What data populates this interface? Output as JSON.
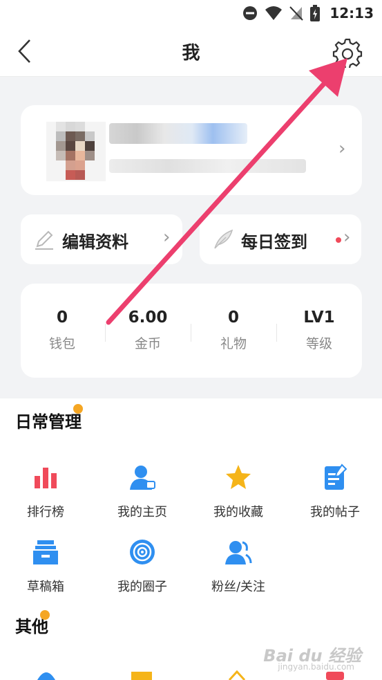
{
  "status": {
    "time": "12:13"
  },
  "header": {
    "title": "我"
  },
  "actions": {
    "edit_profile": "编辑资料",
    "daily_checkin": "每日签到"
  },
  "stats": [
    {
      "value": "0",
      "label": "钱包"
    },
    {
      "value": "6.00",
      "label": "金币"
    },
    {
      "value": "0",
      "label": "礼物"
    },
    {
      "value": "LV1",
      "label": "等级"
    }
  ],
  "daily": {
    "title": "日常管理",
    "items": [
      {
        "label": "排行榜",
        "icon": "ranking-icon"
      },
      {
        "label": "我的主页",
        "icon": "homepage-icon"
      },
      {
        "label": "我的收藏",
        "icon": "star-icon"
      },
      {
        "label": "我的帖子",
        "icon": "posts-icon"
      },
      {
        "label": "草稿箱",
        "icon": "drafts-icon"
      },
      {
        "label": "我的圈子",
        "icon": "circle-icon"
      },
      {
        "label": "粉丝/关注",
        "icon": "fans-icon"
      }
    ]
  },
  "other": {
    "title": "其他"
  },
  "watermark": {
    "text": "Bai du 经验",
    "sub": "jingyan.baidu.com"
  },
  "colors": {
    "accent_red": "#f04a5a",
    "blue": "#2f8ff0",
    "orange": "#f5a623",
    "arrow": "#ec3f6e"
  }
}
